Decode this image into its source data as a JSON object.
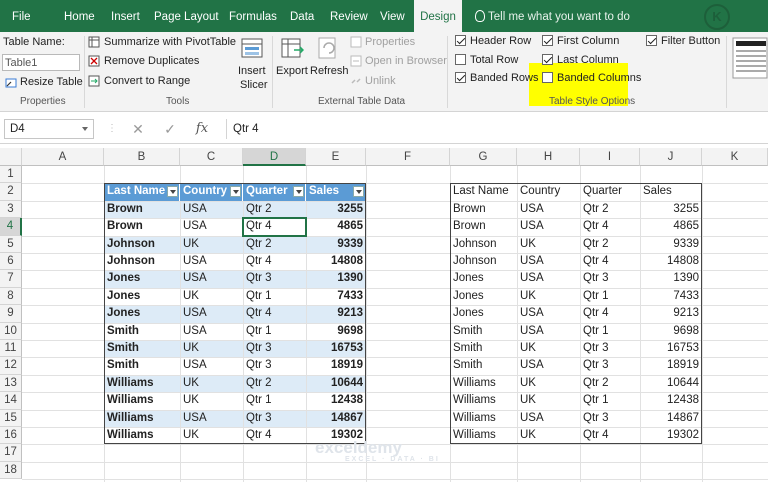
{
  "tabs": [
    "File",
    "Home",
    "Insert",
    "Page Layout",
    "Formulas",
    "Data",
    "Review",
    "View",
    "Design"
  ],
  "tell_me": "Tell me what you want to do",
  "ribbon": {
    "properties": {
      "table_name_label": "Table Name:",
      "table_name_value": "Table1",
      "resize": "Resize Table",
      "group": "Properties"
    },
    "tools": {
      "summarize": "Summarize with PivotTable",
      "remove_dup": "Remove Duplicates",
      "convert": "Convert to Range",
      "insert_slicer_1": "Insert",
      "insert_slicer_2": "Slicer",
      "group": "Tools"
    },
    "external": {
      "export": "Export",
      "refresh": "Refresh",
      "properties": "Properties",
      "open_browser": "Open in Browser",
      "unlink": "Unlink",
      "group": "External Table Data"
    },
    "style_options": {
      "header_row": "Header Row",
      "total_row": "Total Row",
      "banded_rows": "Banded Rows",
      "first_column": "First Column",
      "last_column": "Last Column",
      "banded_columns": "Banded Columns",
      "filter_button": "Filter Button",
      "group": "Table Style Options"
    }
  },
  "formula_bar": {
    "name_box": "D4",
    "cancel": "✕",
    "enter": "✓",
    "fx": "fx",
    "content": "Qtr 4"
  },
  "columns": [
    "A",
    "B",
    "C",
    "D",
    "E",
    "F",
    "G",
    "H",
    "I",
    "J",
    "K"
  ],
  "rows": [
    "1",
    "2",
    "3",
    "4",
    "5",
    "6",
    "7",
    "8",
    "9",
    "10",
    "11",
    "12",
    "13",
    "14",
    "15",
    "16",
    "17",
    "18"
  ],
  "headers": [
    "Last Name",
    "Country",
    "Quarter",
    "Sales"
  ],
  "table": [
    [
      "Brown",
      "USA",
      "Qtr 2",
      "3255"
    ],
    [
      "Brown",
      "USA",
      "Qtr 4",
      "4865"
    ],
    [
      "Johnson",
      "UK",
      "Qtr 2",
      "9339"
    ],
    [
      "Johnson",
      "USA",
      "Qtr 4",
      "14808"
    ],
    [
      "Jones",
      "USA",
      "Qtr 3",
      "1390"
    ],
    [
      "Jones",
      "UK",
      "Qtr 1",
      "7433"
    ],
    [
      "Jones",
      "USA",
      "Qtr 4",
      "9213"
    ],
    [
      "Smith",
      "USA",
      "Qtr 1",
      "9698"
    ],
    [
      "Smith",
      "UK",
      "Qtr 3",
      "16753"
    ],
    [
      "Smith",
      "USA",
      "Qtr 3",
      "18919"
    ],
    [
      "Williams",
      "UK",
      "Qtr 2",
      "10644"
    ],
    [
      "Williams",
      "UK",
      "Qtr 1",
      "12438"
    ],
    [
      "Williams",
      "USA",
      "Qtr 3",
      "14867"
    ],
    [
      "Williams",
      "UK",
      "Qtr 4",
      "19302"
    ]
  ],
  "watermark": {
    "brand": "exceldemy",
    "tagline": "EXCEL · DATA · BI"
  },
  "colors": {
    "excel_green": "#217346",
    "table_header": "#5b9bd5",
    "band": "#ddebf7",
    "highlight": "#ffff00"
  }
}
